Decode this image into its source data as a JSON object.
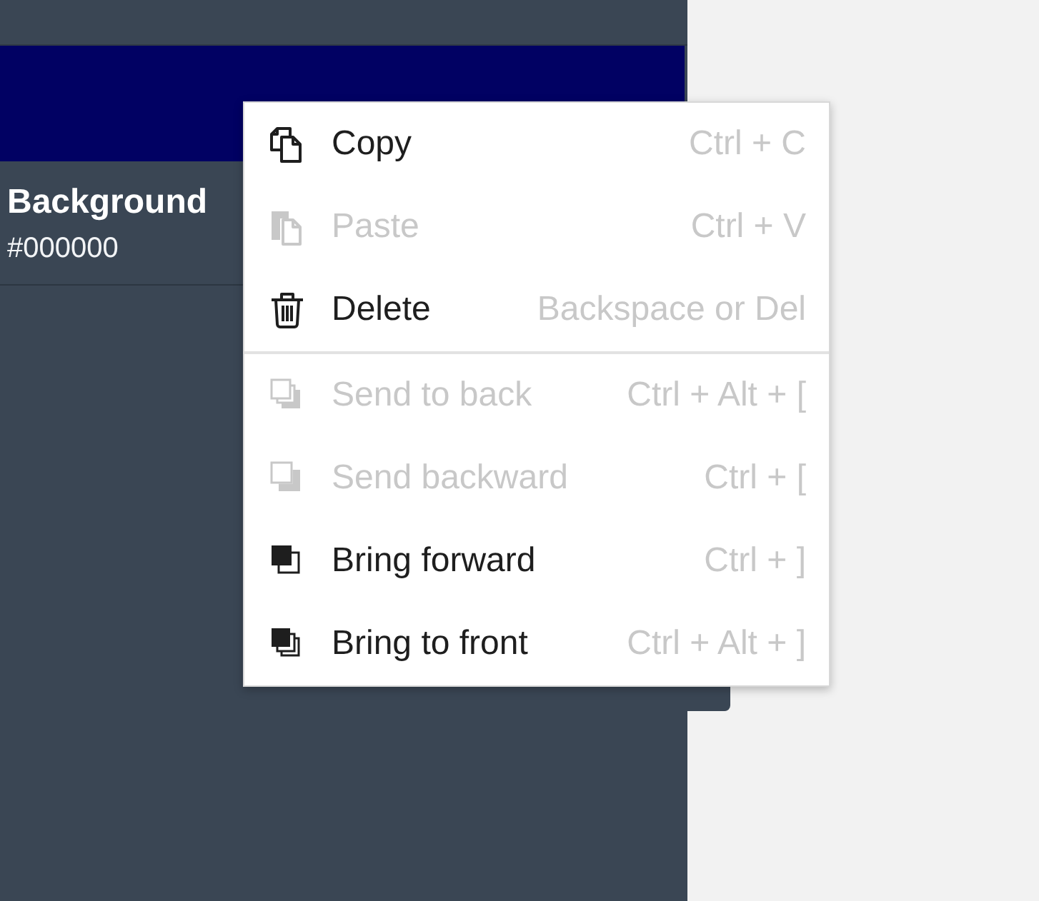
{
  "layer": {
    "name": "Background",
    "value": "#000000"
  },
  "context_menu": {
    "sections": [
      {
        "items": [
          {
            "kind": "copy",
            "label": "Copy",
            "shortcut": "Ctrl + C",
            "disabled": false
          },
          {
            "kind": "paste",
            "label": "Paste",
            "shortcut": "Ctrl + V",
            "disabled": true
          },
          {
            "kind": "delete",
            "label": "Delete",
            "shortcut": "Backspace or Del",
            "disabled": false
          }
        ]
      },
      {
        "items": [
          {
            "kind": "back",
            "label": "Send to back",
            "shortcut": "Ctrl + Alt + [",
            "disabled": true
          },
          {
            "kind": "backward",
            "label": "Send backward",
            "shortcut": "Ctrl + [",
            "disabled": true
          },
          {
            "kind": "forward",
            "label": "Bring forward",
            "shortcut": "Ctrl + ]",
            "disabled": false
          },
          {
            "kind": "front",
            "label": "Bring to front",
            "shortcut": "Ctrl + Alt + ]",
            "disabled": false
          }
        ]
      }
    ]
  }
}
